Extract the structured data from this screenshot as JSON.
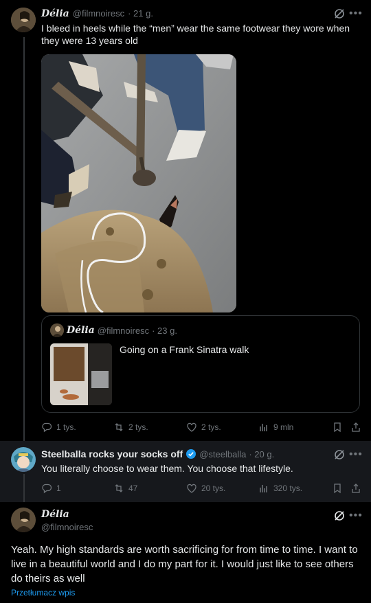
{
  "tweet1": {
    "display_name": "Délia",
    "handle": "@filmnoiresc",
    "time": "· 21 g.",
    "text": "I bleed in heels while the “men” wear the same footwear they wore when they were 13 years old",
    "quoted": {
      "display_name": "Délia",
      "handle": "@filmnoiresc",
      "time": "· 23 g.",
      "text": "Going on a Frank Sinatra walk"
    },
    "actions": {
      "replies": "1 tys.",
      "retweets": "2 tys.",
      "likes": "2 tys.",
      "views": "9 mln"
    }
  },
  "tweet2": {
    "display_name": "Steelballa rocks your socks off",
    "handle": "@steelballa",
    "time": "· 20 g.",
    "text": "You literally choose to wear them. You choose that lifestyle.",
    "actions": {
      "replies": "1",
      "retweets": "47",
      "likes": "20 tys.",
      "views": "320 tys."
    }
  },
  "tweet3": {
    "display_name": "Délia",
    "handle": "@filmnoiresc",
    "text": "Yeah. My high standards are worth sacrificing for from time to time. I want to live in a beautiful world and I do my part for it. I would just like to see others do theirs as well",
    "translate": "Przetłumacz wpis"
  },
  "colors": {
    "background": "#000000",
    "highlight_row": "#16181c",
    "text": "#e7e9ea",
    "muted": "#71767b",
    "link": "#1d9bf0",
    "verified": "#1d9bf0"
  }
}
